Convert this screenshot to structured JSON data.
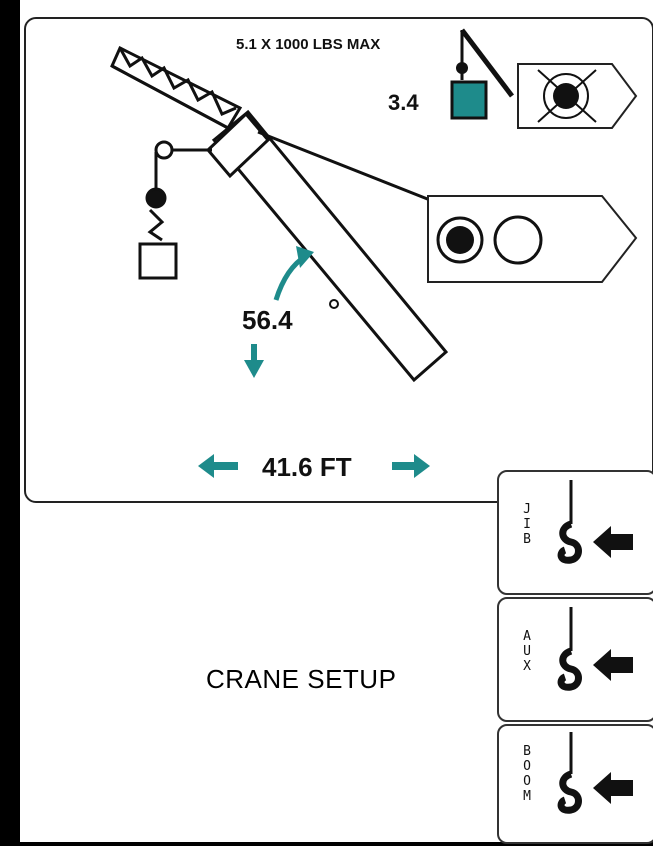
{
  "display": {
    "max_load_label": "5.1 X 1000 LBS MAX",
    "hook_load": "3.4",
    "boom_angle": "56.4",
    "radius": "41.6 FT",
    "screen_title": "CRANE SETUP"
  },
  "hook_buttons": [
    {
      "label": "J\nI\nB"
    },
    {
      "label": "A\nU\nX"
    },
    {
      "label": "B\nO\nO\nM"
    }
  ],
  "colors": {
    "teal": "#1e8b8b",
    "outline": "#222222",
    "background": "#ffffff",
    "frame": "#000000"
  },
  "icons": {
    "light_indicator": "light-off-icon",
    "twin_lights": "twin-light-icon",
    "hook": "hook-icon",
    "arrow": "left-arrow-icon"
  }
}
